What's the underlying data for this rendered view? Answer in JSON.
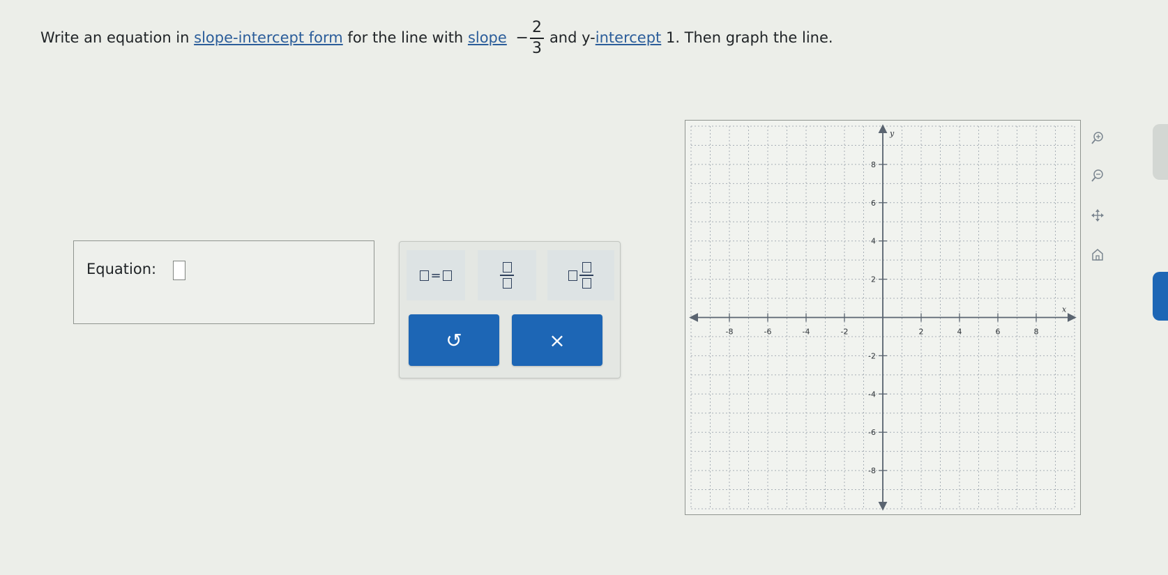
{
  "question": {
    "text_before": "Write an equation in",
    "link_1": "slope-intercept form",
    "text_mid_1": "for the line with",
    "link_2": "slope",
    "slope_sign": "−",
    "slope_num": "2",
    "slope_den": "3",
    "text_mid_2": "and y-",
    "link_3": "intercept",
    "text_end": "1. Then graph the line."
  },
  "equation": {
    "label": "Equation:",
    "value": ""
  },
  "palette": {
    "buttons": [
      {
        "name": "equals-template-button",
        "icon": "box-equals-box-icon"
      },
      {
        "name": "fraction-template-button",
        "icon": "fraction-icon"
      },
      {
        "name": "mixed-number-template-button",
        "icon": "mixed-number-icon"
      }
    ],
    "undo_icon": "↺",
    "clear_icon": "×"
  },
  "graph": {
    "x_axis_label": "x",
    "y_axis_label": "y",
    "x_tick_labels": [
      "-8",
      "-6",
      "-4",
      "-2",
      "2",
      "4",
      "6",
      "8"
    ],
    "y_tick_labels": [
      "8",
      "6",
      "4",
      "2",
      "-2",
      "-4",
      "-6",
      "-8"
    ],
    "range": {
      "xmin": -10,
      "xmax": 10,
      "ymin": -10,
      "ymax": 10
    },
    "grid": true,
    "tools": [
      "zoom-in-icon",
      "zoom-out-icon",
      "pan-icon",
      "home-icon"
    ]
  },
  "colors": {
    "accent_button": "#1d66b5",
    "link": "#2b5d9a",
    "background": "#eceee9"
  }
}
